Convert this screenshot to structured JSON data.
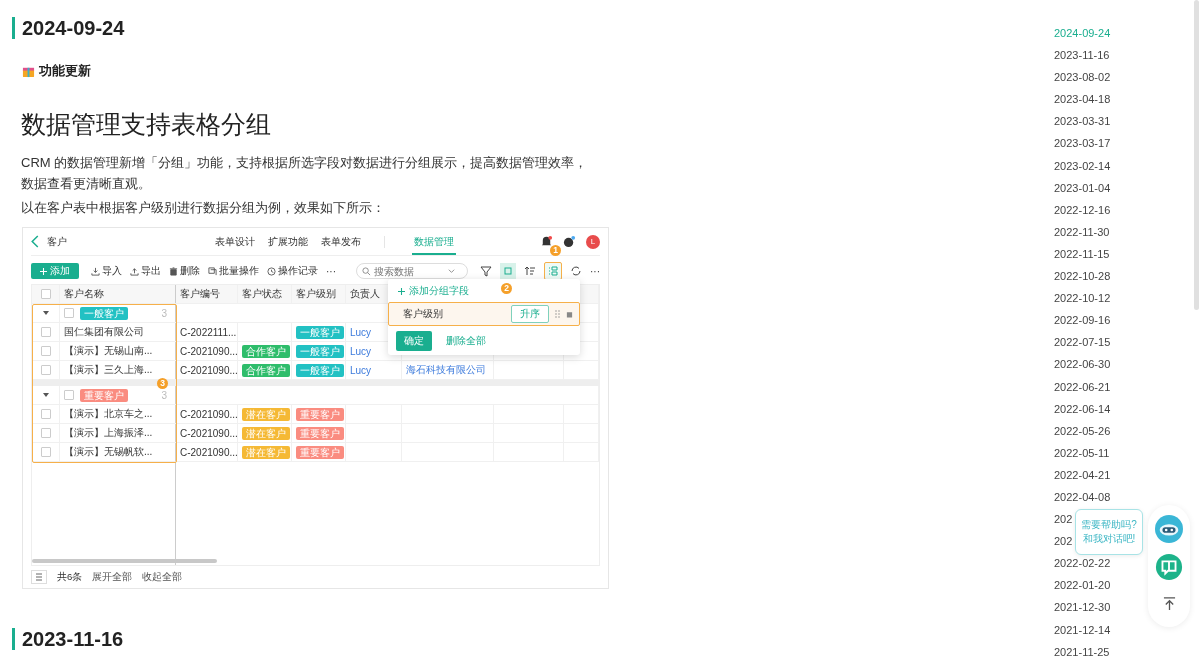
{
  "article": {
    "date": "2024-09-24",
    "badge": "功能更新",
    "title": "数据管理支持表格分组",
    "paragraphs": [
      "CRM 的数据管理新增「分组」功能，支持根据所选字段对数据进行分组展示，提高数据管理效率，数据查看更清晰直观。",
      "以在客户表中根据客户级别进行数据分组为例，效果如下所示："
    ]
  },
  "app": {
    "title": "客户",
    "avatar": "L",
    "tabs": [
      {
        "label": "表单设计",
        "selected": false
      },
      {
        "label": "扩展功能",
        "selected": false
      },
      {
        "label": "表单发布",
        "selected": false
      },
      {
        "label": "数据管理",
        "selected": true
      }
    ],
    "add_button": "添加",
    "actions": [
      {
        "kind": "import",
        "label": "导入"
      },
      {
        "kind": "export",
        "label": "导出"
      },
      {
        "kind": "delete",
        "label": "删除"
      },
      {
        "kind": "batch",
        "label": "批量操作"
      },
      {
        "kind": "history",
        "label": "操作记录"
      }
    ],
    "more": "···",
    "more_right": "···",
    "search": {
      "placeholder": "搜索数据"
    },
    "header_checked": false,
    "columns": [
      "客户名称",
      "客户编号",
      "客户状态",
      "客户级别",
      "负责人"
    ],
    "groups": [
      {
        "label": "一般客户",
        "color": "#22c1c3",
        "count": "3",
        "expanded": true,
        "checked": false,
        "rows": [
          {
            "checked": false,
            "name": "国仁集团有限公司",
            "code": "C-2022111...",
            "level": {
              "text": "一般客户",
              "color": "#22c1c3"
            },
            "owner": "Lucy"
          },
          {
            "checked": false,
            "name": "【演示】无锡山南...",
            "code": "C-2021090...",
            "status": {
              "text": "合作客户",
              "color": "#2ebd6b"
            },
            "level": {
              "text": "一般客户",
              "color": "#22c1c3"
            },
            "owner": "Lucy"
          },
          {
            "checked": false,
            "name": "【演示】三久上海...",
            "code": "C-2021090...",
            "status": {
              "text": "合作客户",
              "color": "#2ebd6b"
            },
            "level": {
              "text": "一般客户",
              "color": "#22c1c3"
            },
            "owner": "Lucy",
            "column_7": "海石科技有限公司"
          }
        ]
      },
      {
        "label": "重要客户",
        "color": "#fa8c80",
        "count": "3",
        "expanded": true,
        "checked": false,
        "rows": [
          {
            "checked": false,
            "name": "【演示】北京车之...",
            "code": "C-2021090...",
            "status": {
              "text": "潜在客户",
              "color": "#f5b935"
            },
            "level": {
              "text": "重要客户",
              "color": "#fa8c80"
            }
          },
          {
            "checked": false,
            "name": "【演示】上海振泽...",
            "code": "C-2021090...",
            "status": {
              "text": "潜在客户",
              "color": "#f5b935"
            },
            "level": {
              "text": "重要客户",
              "color": "#fa8c80"
            }
          },
          {
            "checked": false,
            "name": "【演示】无锡帆软...",
            "code": "C-2021090...",
            "status": {
              "text": "潜在客户",
              "color": "#f5b935"
            },
            "level": {
              "text": "重要客户",
              "color": "#fa8c80"
            }
          }
        ]
      }
    ],
    "popup": {
      "add_field": "添加分组字段",
      "field": "客户级别",
      "sort": "升序",
      "confirm": "确定",
      "delete_all": "删除全部"
    },
    "markers": [
      "1",
      "2",
      "3"
    ],
    "footer": {
      "total": "共6条",
      "expand_all": "展开全部",
      "collapse_all": "收起全部"
    }
  },
  "next_date": "2023-11-16",
  "toc": [
    {
      "date": "2024-09-24",
      "selected": true
    },
    {
      "date": "2023-11-16",
      "selected": false
    },
    {
      "date": "2023-08-02",
      "selected": false
    },
    {
      "date": "2023-04-18",
      "selected": false
    },
    {
      "date": "2023-03-31",
      "selected": false
    },
    {
      "date": "2023-03-17",
      "selected": false
    },
    {
      "date": "2023-02-14",
      "selected": false
    },
    {
      "date": "2023-01-04",
      "selected": false
    },
    {
      "date": "2022-12-16",
      "selected": false
    },
    {
      "date": "2022-11-30",
      "selected": false
    },
    {
      "date": "2022-11-15",
      "selected": false
    },
    {
      "date": "2022-10-28",
      "selected": false
    },
    {
      "date": "2022-10-12",
      "selected": false
    },
    {
      "date": "2022-09-16",
      "selected": false
    },
    {
      "date": "2022-07-15",
      "selected": false
    },
    {
      "date": "2022-06-30",
      "selected": false
    },
    {
      "date": "2022-06-21",
      "selected": false
    },
    {
      "date": "2022-06-14",
      "selected": false
    },
    {
      "date": "2022-05-26",
      "selected": false
    },
    {
      "date": "2022-05-11",
      "selected": false
    },
    {
      "date": "2022-04-21",
      "selected": false
    },
    {
      "date": "2022-04-08",
      "selected": false
    },
    {
      "date": "202",
      "selected": false
    },
    {
      "date": "202",
      "selected": false
    },
    {
      "date": "2022-02-22",
      "selected": false
    },
    {
      "date": "2022-01-20",
      "selected": false
    },
    {
      "date": "2021-12-30",
      "selected": false
    },
    {
      "date": "2021-12-14",
      "selected": false
    },
    {
      "date": "2021-11-25",
      "selected": false
    }
  ],
  "help": {
    "lines": [
      "需要帮助吗?",
      "和我对话吧!"
    ]
  }
}
